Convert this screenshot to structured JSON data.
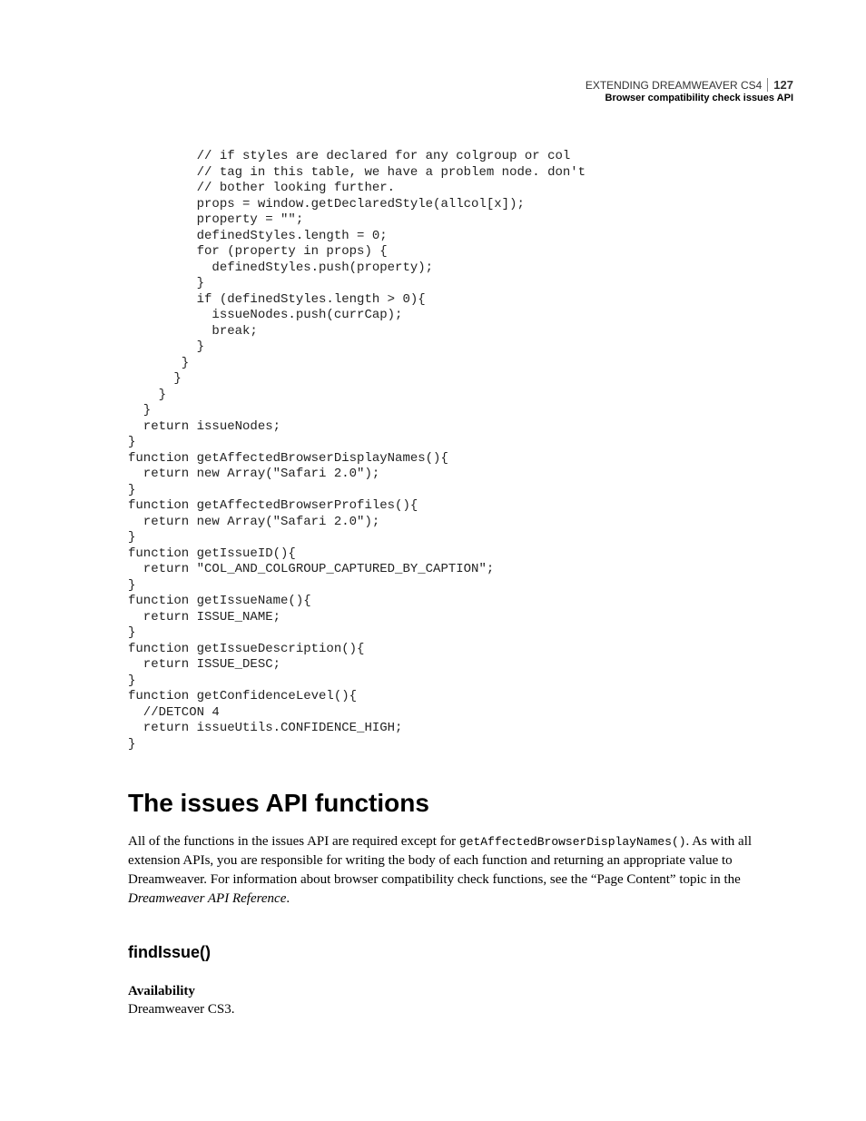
{
  "header": {
    "product": "EXTENDING DREAMWEAVER CS4",
    "chapter": "Browser compatibility check issues API",
    "pagenum": "127"
  },
  "code": "         // if styles are declared for any colgroup or col\n         // tag in this table, we have a problem node. don't\n         // bother looking further.\n         props = window.getDeclaredStyle(allcol[x]);\n         property = \"\";\n         definedStyles.length = 0;\n         for (property in props) {\n           definedStyles.push(property);\n         }\n         if (definedStyles.length > 0){\n           issueNodes.push(currCap);\n           break;\n         }\n       }\n      }\n    }\n  }\n  return issueNodes;\n}\nfunction getAffectedBrowserDisplayNames(){\n  return new Array(\"Safari 2.0\");\n}\nfunction getAffectedBrowserProfiles(){\n  return new Array(\"Safari 2.0\");\n}\nfunction getIssueID(){\n  return \"COL_AND_COLGROUP_CAPTURED_BY_CAPTION\";\n}\nfunction getIssueName(){\n  return ISSUE_NAME;\n}\nfunction getIssueDescription(){\n  return ISSUE_DESC;\n}\nfunction getConfidenceLevel(){\n  //DETCON 4\n  return issueUtils.CONFIDENCE_HIGH;\n}",
  "section_heading": "The issues API functions",
  "intro_para_pre": "All of the functions in the issues API are required except for ",
  "intro_para_fn": "getAffectedBrowserDisplayNames()",
  "intro_para_post": ". As with all extension APIs, you are responsible for writing the body of each function and returning an appropriate value to Dreamweaver. For information about browser compatibility check functions, see the “Page Content” topic in the ",
  "intro_para_emph": "Dreamweaver API Reference",
  "intro_para_end": ".",
  "subsection_heading": "findIssue()",
  "availability_label": "Availability",
  "availability_value": "Dreamweaver CS3."
}
